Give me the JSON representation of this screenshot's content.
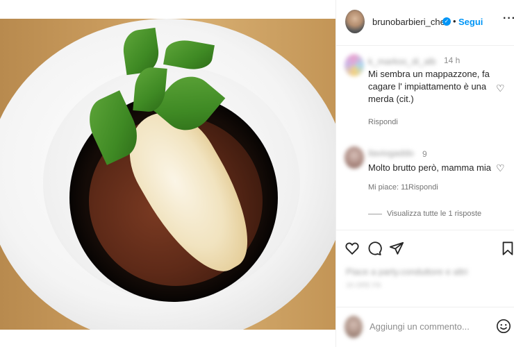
{
  "post": {
    "username": "brunobarbieri_chef",
    "separator": "•",
    "follow_label": "Segui",
    "more_label": "···"
  },
  "comments": [
    {
      "author": "k_markss_di_alb",
      "time": "14 h",
      "text_lines": [
        "Mi sembra un mappazzone, fa",
        "cagare l' impiattamento è una",
        "merda (cit.)"
      ],
      "reply_label": "Rispondi"
    },
    {
      "author": "ilaviogaddo",
      "time": "9",
      "text_lines": [
        "Molto brutto però, mamma mia"
      ],
      "likes_label": "Mi piace: 11",
      "reply_label": "Rispondi"
    }
  ],
  "view_replies_label": "Visualizza tutte le 1 risposte",
  "actions": {
    "liked_by": "Piace a party.conduttore e altri",
    "date": "16 ORE FA"
  },
  "add_comment": {
    "placeholder": "Aggiungi un commento..."
  },
  "icons": {
    "verified": "verified-badge-icon",
    "heart": "heart-icon",
    "comment": "comment-icon",
    "share": "paper-plane-icon",
    "save": "bookmark-icon",
    "emoji": "emoji-icon"
  },
  "colors": {
    "accent": "#0095f6",
    "text": "#262626",
    "muted": "#8e8e8e"
  }
}
